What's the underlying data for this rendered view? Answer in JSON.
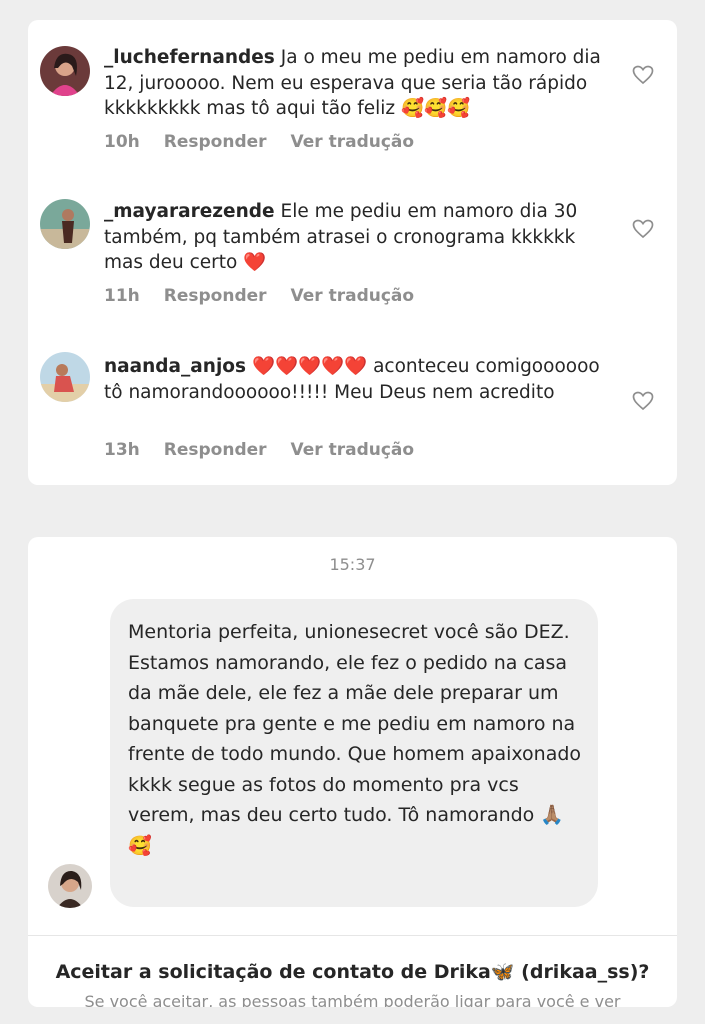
{
  "comments": [
    {
      "username": "_luchefernandes",
      "text": "Ja o meu me pediu em namoro dia 12, jurooooo. Nem eu esperava que seria tão rápido kkkkkkkkk mas tô aqui tão feliz 🥰🥰🥰",
      "time": "10h",
      "reply": "Responder",
      "translate": "Ver tradução"
    },
    {
      "username": "_mayararezende",
      "text": "Ele me pediu em namoro dia 30 também, pq também atrasei o cronograma kkkkkk mas deu certo ❤️",
      "time": "11h",
      "reply": "Responder",
      "translate": "Ver tradução"
    },
    {
      "username": "naanda_anjos",
      "text": "❤️❤️❤️❤️❤️ aconteceu comigoooooo tô namorandoooooo!!!!! Meu Deus nem acredito",
      "time": "13h",
      "reply": "Responder",
      "translate": "Ver tradução"
    }
  ],
  "dm": {
    "timestamp": "15:37",
    "message": "Mentoria perfeita, unionesecret você são DEZ. Estamos namorando, ele fez o pedido na casa da mãe dele, ele fez a mãe dele preparar um banquete pra gente e me pediu em namoro na frente de todo mundo. Que homem apaixonado kkkk segue as fotos do momento pra vcs verem, mas deu certo tudo. Tô namorando 🙏🏽🥰",
    "accept_prompt": "Aceitar a solicitação de contato de Drika🦋 (drikaa_ss)?",
    "accept_subtext": "Se você aceitar, as pessoas também poderão ligar para você e ver"
  }
}
